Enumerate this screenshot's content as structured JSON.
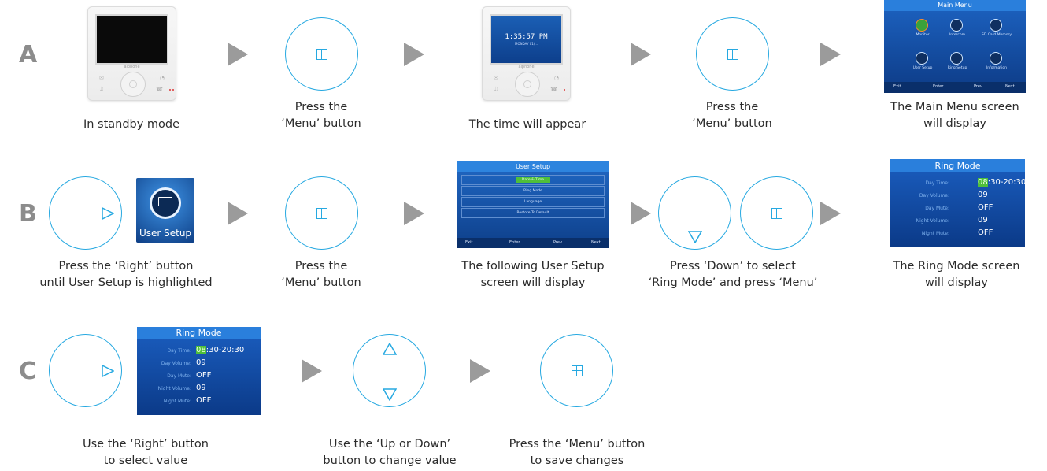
{
  "rows": [
    "A",
    "B",
    "C"
  ],
  "row_a": {
    "captions": {
      "standby": "In standby mode",
      "press_menu_1_l1": "Press the",
      "press_menu_1_l2": "‘Menu’ button",
      "time_appear": "The time will appear",
      "press_menu_2_l1": "Press the",
      "press_menu_2_l2": "‘Menu’ button",
      "main_menu_l1": "The Main Menu screen",
      "main_menu_l2": "will display"
    },
    "clock": {
      "time": "1:35:57 PM",
      "date": "MONDAY 01/..."
    },
    "device_brand": "aiphone",
    "main_menu": {
      "title": "Main Menu",
      "items": [
        "Monitor",
        "Intercom",
        "SD Card Memory",
        "User Setup",
        "Ring Setup",
        "Information"
      ],
      "bar": [
        "Exit",
        "Enter",
        "Prev",
        "Next"
      ]
    }
  },
  "row_b": {
    "captions": {
      "press_right_l1": "Press the ‘Right’ button",
      "press_right_l2": "until User Setup is highlighted",
      "press_menu_l1": "Press the",
      "press_menu_l2": "‘Menu’ button",
      "user_setup_l1": "The following User Setup",
      "user_setup_l2": "screen will display",
      "press_down_l1": "Press ‘Down’  to select",
      "press_down_l2": "‘Ring Mode’  and press ‘Menu’",
      "ring_mode_l1": "The Ring Mode screen",
      "ring_mode_l2": "will display"
    },
    "user_setup_tile": "User Setup",
    "user_setup_screen": {
      "title": "User Setup",
      "items": [
        "Date & Time",
        "Ring Mode",
        "Language",
        "Restore To Default"
      ],
      "bar": [
        "Exit",
        "Enter",
        "Prev",
        "Next"
      ]
    }
  },
  "row_c": {
    "captions": {
      "use_right_l1": "Use the ‘Right’ button",
      "use_right_l2": "to select value",
      "use_updown_l1": "Use the ‘Up or Down’",
      "use_updown_l2": "button to change value",
      "press_save_l1": "Press the ‘Menu’ button",
      "press_save_l2": "to save changes"
    }
  },
  "ring_mode": {
    "title": "Ring Mode",
    "rows": [
      {
        "key": "Day Time:",
        "hl": "08",
        "val": ":30-20:30"
      },
      {
        "key": "Day Volume:",
        "hl": "",
        "val": "09"
      },
      {
        "key": "Day Mute:",
        "hl": "",
        "val": "OFF"
      },
      {
        "key": "Night Volume:",
        "hl": "",
        "val": "09"
      },
      {
        "key": "Night Mute:",
        "hl": "",
        "val": "OFF"
      }
    ]
  },
  "colors": {
    "accent": "#27a9e1",
    "arrow": "#9b9b9b",
    "letter": "#8c8c8c",
    "screen_blue": "#1b5ec0"
  },
  "icons": [
    "menu-button-icon",
    "right-arrow-icon",
    "down-arrow-icon",
    "up-arrow-icon",
    "flow-arrow-icon"
  ]
}
